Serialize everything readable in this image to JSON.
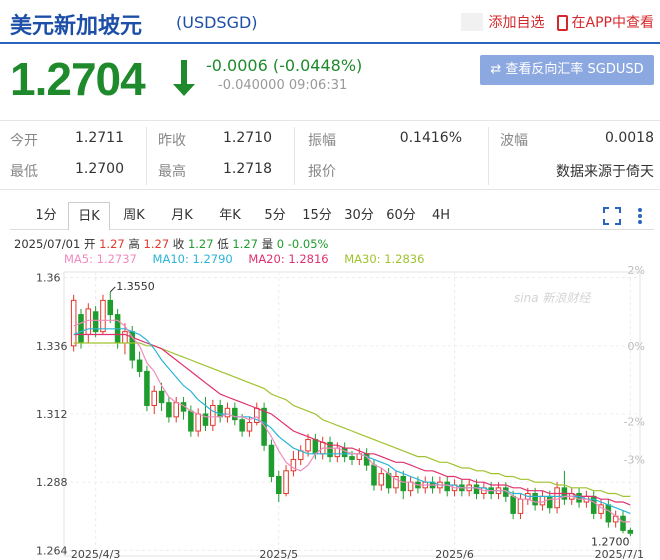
{
  "header": {
    "title": "美元新加坡元",
    "code": "(USDSGD)",
    "add_watchlist": "添加自选",
    "app_view": "在APP中查看"
  },
  "quote": {
    "price": "1.2704",
    "change": "-0.0006 (-0.0448%)",
    "change_detail": "-0.040000 09:06:31",
    "reverse_button": "⇄ 查看反向汇率 SGDUSD",
    "arrow_color": "#1f8a2c"
  },
  "stats": {
    "open_label": "今开",
    "open": "1.2711",
    "prev_close_label": "昨收",
    "prev_close": "1.2710",
    "amplitude_label": "振幅",
    "amplitude": "0.1416%",
    "range_label": "波幅",
    "range": "0.0018",
    "low_label": "最低",
    "low": "1.2700",
    "high_label": "最高",
    "high": "1.2718",
    "report_label": "报价",
    "source": "数据来源于倚天"
  },
  "tabs": [
    "1分",
    "日K",
    "周K",
    "月K",
    "年K",
    "5分",
    "15分",
    "30分",
    "60分",
    "4H"
  ],
  "active_tab": "日K",
  "tools": [
    "fullscreen-icon",
    "more-icon"
  ],
  "chart_info": {
    "date": "2025/07/01",
    "open_label": "开",
    "open": "1.27",
    "high_label": "高",
    "high": "1.27",
    "close_label": "收",
    "close": "1.27",
    "low_label": "低",
    "low": "1.27",
    "vol_label": "量",
    "vol": "0",
    "pct": "-0.05%",
    "ma5": "MA5: 1.2737",
    "ma10": "MA10: 1.2790",
    "ma20": "MA20: 1.2816",
    "ma30": "MA30: 1.2836"
  },
  "colors": {
    "up": "#e2382d",
    "down": "#1f9c2e",
    "ma5": "#f08bbf",
    "ma10": "#2ab5d8",
    "ma20": "#e0306f",
    "ma30": "#9fc22e",
    "brand": "#1d4fa8"
  },
  "chart_data": {
    "type": "candlestick",
    "y_ticks": [
      "1.36",
      "1.336",
      "1.312",
      "1.288",
      "1.264"
    ],
    "y_tick_values": [
      1.36,
      1.336,
      1.312,
      1.288,
      1.264
    ],
    "pct_ticks": [
      "2%",
      "0%",
      "-2%",
      "-3%"
    ],
    "pct_tick_values": [
      2,
      0,
      -2,
      -3
    ],
    "x_labels": [
      "2025/4/3",
      "2025/5",
      "2025/6",
      "2025/7/1"
    ],
    "max_label": "1.3550",
    "min_label": "1.2700",
    "watermark": "sina 新浪财经",
    "ylim": [
      1.262,
      1.362
    ],
    "candles": [
      [
        1.336,
        1.352,
        1.334,
        1.354
      ],
      [
        1.347,
        1.337,
        1.335,
        1.349
      ],
      [
        1.34,
        1.349,
        1.337,
        1.351
      ],
      [
        1.348,
        1.341,
        1.339,
        1.35
      ],
      [
        1.341,
        1.352,
        1.34,
        1.354
      ],
      [
        1.352,
        1.347,
        1.344,
        1.355
      ],
      [
        1.347,
        1.337,
        1.335,
        1.349
      ],
      [
        1.337,
        1.341,
        1.333,
        1.344
      ],
      [
        1.341,
        1.331,
        1.328,
        1.343
      ],
      [
        1.331,
        1.327,
        1.325,
        1.334
      ],
      [
        1.327,
        1.315,
        1.313,
        1.329
      ],
      [
        1.315,
        1.32,
        1.312,
        1.322
      ],
      [
        1.32,
        1.316,
        1.313,
        1.323
      ],
      [
        1.316,
        1.311,
        1.309,
        1.318
      ],
      [
        1.311,
        1.316,
        1.309,
        1.318
      ],
      [
        1.316,
        1.313,
        1.31,
        1.318
      ],
      [
        1.313,
        1.306,
        1.304,
        1.315
      ],
      [
        1.306,
        1.312,
        1.304,
        1.314
      ],
      [
        1.312,
        1.308,
        1.306,
        1.318
      ],
      [
        1.308,
        1.315,
        1.306,
        1.317
      ],
      [
        1.315,
        1.311,
        1.309,
        1.317
      ],
      [
        1.311,
        1.314,
        1.309,
        1.316
      ],
      [
        1.314,
        1.31,
        1.308,
        1.316
      ],
      [
        1.31,
        1.306,
        1.304,
        1.312
      ],
      [
        1.306,
        1.309,
        1.304,
        1.311
      ],
      [
        1.309,
        1.314,
        1.308,
        1.316
      ],
      [
        1.314,
        1.301,
        1.299,
        1.316
      ],
      [
        1.301,
        1.29,
        1.288,
        1.303
      ],
      [
        1.29,
        1.284,
        1.281,
        1.292
      ],
      [
        1.284,
        1.292,
        1.283,
        1.294
      ],
      [
        1.292,
        1.296,
        1.29,
        1.299
      ],
      [
        1.296,
        1.299,
        1.294,
        1.301
      ],
      [
        1.299,
        1.303,
        1.297,
        1.305
      ],
      [
        1.303,
        1.298,
        1.296,
        1.305
      ],
      [
        1.298,
        1.302,
        1.296,
        1.304
      ],
      [
        1.302,
        1.297,
        1.295,
        1.304
      ],
      [
        1.297,
        1.3,
        1.295,
        1.302
      ],
      [
        1.3,
        1.297,
        1.295,
        1.302
      ],
      [
        1.297,
        1.296,
        1.294,
        1.299
      ],
      [
        1.296,
        1.298,
        1.294,
        1.3
      ],
      [
        1.298,
        1.294,
        1.292,
        1.3
      ],
      [
        1.294,
        1.287,
        1.285,
        1.296
      ],
      [
        1.287,
        1.291,
        1.285,
        1.293
      ],
      [
        1.291,
        1.286,
        1.284,
        1.293
      ],
      [
        1.286,
        1.29,
        1.284,
        1.292
      ],
      [
        1.29,
        1.285,
        1.282,
        1.292
      ],
      [
        1.285,
        1.288,
        1.283,
        1.29
      ],
      [
        1.288,
        1.286,
        1.284,
        1.29
      ],
      [
        1.286,
        1.288,
        1.284,
        1.29
      ],
      [
        1.288,
        1.286,
        1.284,
        1.29
      ],
      [
        1.286,
        1.288,
        1.284,
        1.29
      ],
      [
        1.288,
        1.285,
        1.283,
        1.29
      ],
      [
        1.285,
        1.287,
        1.283,
        1.289
      ],
      [
        1.287,
        1.285,
        1.283,
        1.289
      ],
      [
        1.285,
        1.287,
        1.283,
        1.289
      ],
      [
        1.287,
        1.284,
        1.282,
        1.289
      ],
      [
        1.284,
        1.286,
        1.282,
        1.288
      ],
      [
        1.286,
        1.284,
        1.282,
        1.288
      ],
      [
        1.284,
        1.286,
        1.282,
        1.288
      ],
      [
        1.286,
        1.283,
        1.281,
        1.288
      ],
      [
        1.283,
        1.277,
        1.275,
        1.285
      ],
      [
        1.277,
        1.282,
        1.275,
        1.284
      ],
      [
        1.282,
        1.284,
        1.28,
        1.286
      ],
      [
        1.284,
        1.28,
        1.278,
        1.286
      ],
      [
        1.28,
        1.283,
        1.278,
        1.285
      ],
      [
        1.283,
        1.279,
        1.277,
        1.285
      ],
      [
        1.279,
        1.286,
        1.277,
        1.288
      ],
      [
        1.286,
        1.282,
        1.28,
        1.292
      ],
      [
        1.282,
        1.284,
        1.28,
        1.286
      ],
      [
        1.284,
        1.281,
        1.279,
        1.286
      ],
      [
        1.281,
        1.283,
        1.279,
        1.285
      ],
      [
        1.283,
        1.277,
        1.275,
        1.285
      ],
      [
        1.277,
        1.28,
        1.275,
        1.282
      ],
      [
        1.28,
        1.274,
        1.272,
        1.282
      ],
      [
        1.274,
        1.276,
        1.272,
        1.278
      ],
      [
        1.276,
        1.271,
        1.27,
        1.278
      ],
      [
        1.271,
        1.27,
        1.269,
        1.272
      ]
    ],
    "ma5": [
      1.343,
      1.344,
      1.345,
      1.345,
      1.345,
      1.345,
      1.345,
      1.343,
      1.339,
      1.336,
      1.33,
      1.327,
      1.322,
      1.318,
      1.316,
      1.315,
      1.313,
      1.312,
      1.311,
      1.311,
      1.311,
      1.312,
      1.311,
      1.311,
      1.31,
      1.311,
      1.308,
      1.304,
      1.299,
      1.295,
      1.293,
      1.292,
      1.294,
      1.298,
      1.3,
      1.3,
      1.3,
      1.299,
      1.298,
      1.298,
      1.297,
      1.294,
      1.293,
      1.291,
      1.289,
      1.288,
      1.288,
      1.287,
      1.287,
      1.287,
      1.287,
      1.287,
      1.286,
      1.286,
      1.286,
      1.286,
      1.285,
      1.285,
      1.285,
      1.285,
      1.283,
      1.282,
      1.282,
      1.281,
      1.281,
      1.282,
      1.282,
      1.283,
      1.283,
      1.282,
      1.282,
      1.281,
      1.279,
      1.278,
      1.276,
      1.274,
      1.274
    ],
    "ma10": [
      1.34,
      1.341,
      1.342,
      1.342,
      1.342,
      1.342,
      1.342,
      1.342,
      1.341,
      1.34,
      1.338,
      1.335,
      1.331,
      1.328,
      1.325,
      1.322,
      1.32,
      1.317,
      1.315,
      1.313,
      1.312,
      1.312,
      1.311,
      1.311,
      1.311,
      1.31,
      1.309,
      1.307,
      1.304,
      1.302,
      1.3,
      1.299,
      1.298,
      1.298,
      1.298,
      1.298,
      1.298,
      1.298,
      1.298,
      1.298,
      1.297,
      1.296,
      1.295,
      1.294,
      1.292,
      1.291,
      1.29,
      1.289,
      1.288,
      1.288,
      1.287,
      1.287,
      1.287,
      1.286,
      1.286,
      1.286,
      1.286,
      1.285,
      1.285,
      1.285,
      1.284,
      1.284,
      1.283,
      1.283,
      1.283,
      1.283,
      1.283,
      1.283,
      1.283,
      1.283,
      1.282,
      1.282,
      1.281,
      1.28,
      1.279,
      1.278,
      1.277
    ],
    "ma20": [
      1.34,
      1.34,
      1.34,
      1.34,
      1.34,
      1.34,
      1.34,
      1.34,
      1.339,
      1.338,
      1.337,
      1.336,
      1.335,
      1.333,
      1.331,
      1.329,
      1.327,
      1.325,
      1.323,
      1.321,
      1.319,
      1.318,
      1.317,
      1.316,
      1.315,
      1.314,
      1.313,
      1.312,
      1.31,
      1.308,
      1.306,
      1.305,
      1.304,
      1.303,
      1.302,
      1.301,
      1.301,
      1.3,
      1.3,
      1.299,
      1.298,
      1.298,
      1.297,
      1.296,
      1.295,
      1.295,
      1.294,
      1.293,
      1.292,
      1.292,
      1.291,
      1.29,
      1.29,
      1.289,
      1.289,
      1.288,
      1.288,
      1.287,
      1.287,
      1.287,
      1.286,
      1.286,
      1.285,
      1.285,
      1.285,
      1.284,
      1.284,
      1.284,
      1.284,
      1.283,
      1.283,
      1.283,
      1.282,
      1.282,
      1.281,
      1.281,
      1.28
    ],
    "ma30": [
      1.337,
      1.337,
      1.337,
      1.337,
      1.337,
      1.337,
      1.337,
      1.337,
      1.337,
      1.337,
      1.336,
      1.336,
      1.335,
      1.334,
      1.333,
      1.332,
      1.331,
      1.33,
      1.329,
      1.328,
      1.327,
      1.326,
      1.325,
      1.324,
      1.323,
      1.322,
      1.321,
      1.319,
      1.318,
      1.317,
      1.315,
      1.314,
      1.313,
      1.312,
      1.31,
      1.309,
      1.308,
      1.307,
      1.306,
      1.305,
      1.304,
      1.303,
      1.302,
      1.301,
      1.3,
      1.299,
      1.298,
      1.297,
      1.297,
      1.296,
      1.295,
      1.295,
      1.294,
      1.293,
      1.293,
      1.292,
      1.292,
      1.291,
      1.291,
      1.29,
      1.29,
      1.289,
      1.289,
      1.288,
      1.288,
      1.288,
      1.287,
      1.287,
      1.286,
      1.286,
      1.286,
      1.285,
      1.285,
      1.284,
      1.284,
      1.283,
      1.283
    ]
  }
}
